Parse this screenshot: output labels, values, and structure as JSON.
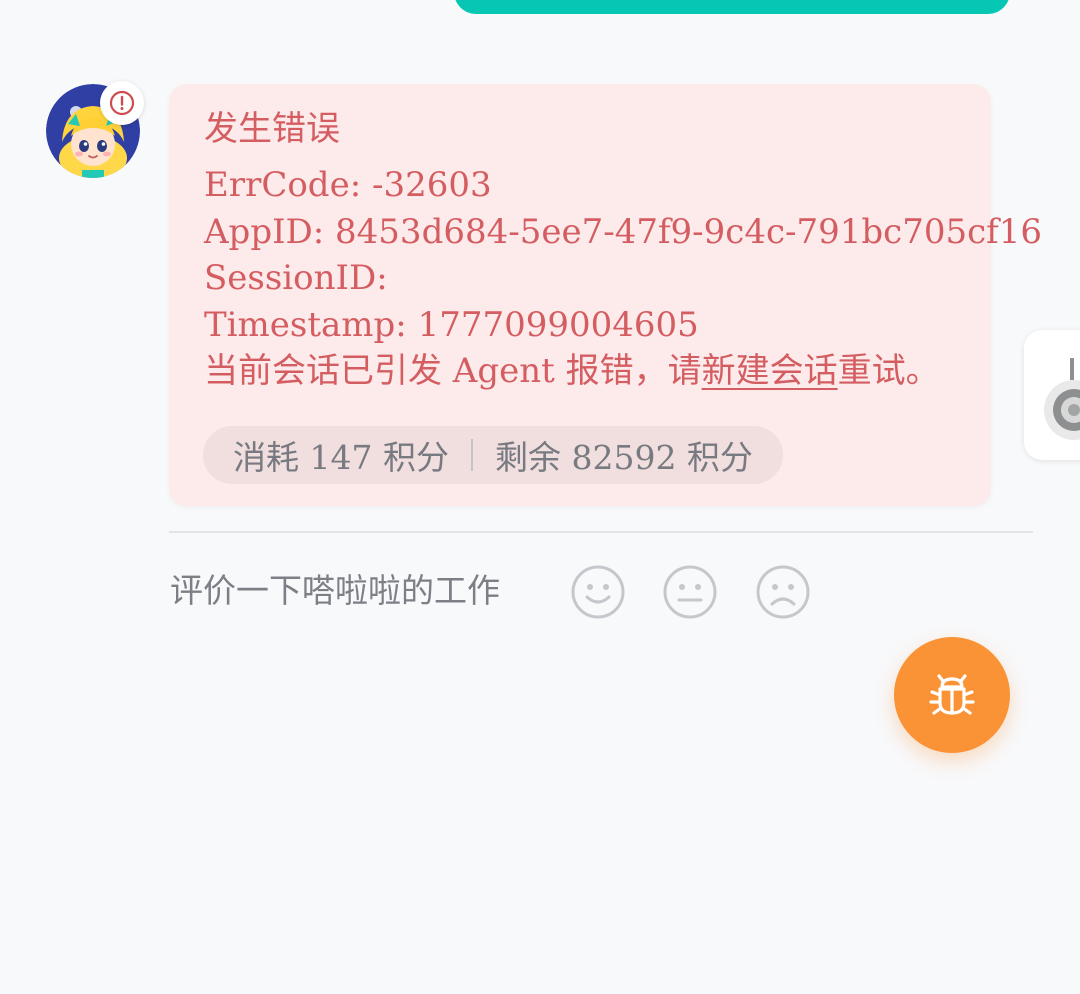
{
  "error_card": {
    "title": "发生错误",
    "lines": [
      "ErrCode: -32603",
      "AppID: 8453d684-5ee7-47f9-9c4c-791bc705cf16",
      "SessionID:",
      "Timestamp: 1777099004605"
    ],
    "message_prefix": "当前会话已引发 Agent 报错，请",
    "message_link": "新建会话",
    "message_suffix": "重试。",
    "usage": {
      "consumed": "消耗 147 积分",
      "remaining": "剩余 82592 积分"
    }
  },
  "feedback": {
    "label": "评价一下嗒啦啦的工作",
    "faces": [
      "smile-face-icon",
      "neutral-face-icon",
      "sad-face-icon"
    ]
  },
  "icons": {
    "avatar_badge": "alert-circle-icon",
    "fab": "bug-icon"
  },
  "colors": {
    "accent_teal": "#05c7b3",
    "error_text": "#d45d61",
    "error_bg": "#fdeaea",
    "fab_orange": "#fa9236"
  }
}
